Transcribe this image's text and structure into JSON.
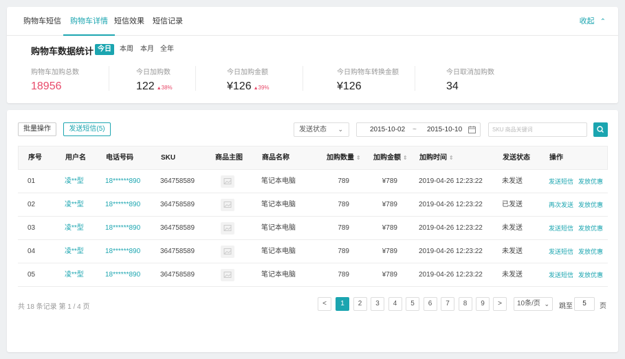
{
  "tabs": [
    "购物车短信",
    "购物车详情",
    "短信效果",
    "短信记录"
  ],
  "active_tab": 1,
  "collapse_label": "收起",
  "stats": {
    "title": "购物车数据统计",
    "periods": [
      "今日",
      "本周",
      "本月",
      "全年"
    ],
    "items": [
      {
        "label": "购物车加购总数",
        "value": "18956",
        "delta": ""
      },
      {
        "label": "今日加购数",
        "value": "122",
        "delta": "38%"
      },
      {
        "label": "今日加购金额",
        "value": "¥126",
        "delta": "39%"
      },
      {
        "label": "今日购物车转换金额",
        "value": "¥126",
        "delta": ""
      },
      {
        "label": "今日取消加购数",
        "value": "34",
        "delta": ""
      }
    ]
  },
  "toolbar": {
    "batch_label": "批量操作",
    "send_sms_label": "发送短信(5)",
    "status_select": "发送状态",
    "date_from": "2015-10-02",
    "date_sep": "~",
    "date_to": "2015-10-10",
    "search_placeholder": "SKU  商品关键词"
  },
  "table": {
    "headers": [
      "序号",
      "用户名",
      "电话号码",
      "SKU",
      "商品主图",
      "商品名称",
      "加购数量",
      "加购金额",
      "加购时间",
      "发送状态",
      "操作"
    ],
    "rows": [
      {
        "no": "01",
        "user": "凌**型",
        "phone": "18******890",
        "sku": "364758589",
        "name": "笔记本电脑",
        "qty": "789",
        "amount": "¥789",
        "time": "2019-04-26 12:23:22",
        "status": "未发送",
        "action1": "发送短信",
        "action2": "发放优惠"
      },
      {
        "no": "02",
        "user": "凌**型",
        "phone": "18******890",
        "sku": "364758589",
        "name": "笔记本电脑",
        "qty": "789",
        "amount": "¥789",
        "time": "2019-04-26 12:23:22",
        "status": "已发送",
        "action1": "再次发送",
        "action2": "发放优惠"
      },
      {
        "no": "03",
        "user": "凌**型",
        "phone": "18******890",
        "sku": "364758589",
        "name": "笔记本电脑",
        "qty": "789",
        "amount": "¥789",
        "time": "2019-04-26 12:23:22",
        "status": "未发送",
        "action1": "发送短信",
        "action2": "发放优惠"
      },
      {
        "no": "04",
        "user": "凌**型",
        "phone": "18******890",
        "sku": "364758589",
        "name": "笔记本电脑",
        "qty": "789",
        "amount": "¥789",
        "time": "2019-04-26 12:23:22",
        "status": "未发送",
        "action1": "发送短信",
        "action2": "发放优惠"
      },
      {
        "no": "05",
        "user": "凌**型",
        "phone": "18******890",
        "sku": "364758589",
        "name": "笔记本电脑",
        "qty": "789",
        "amount": "¥789",
        "time": "2019-04-26 12:23:22",
        "status": "未发送",
        "action1": "发送短信",
        "action2": "发放优惠"
      }
    ]
  },
  "pagination": {
    "summary": "共 18 条记录 第 1 / 4 页",
    "prev": "<",
    "pages": [
      "1",
      "2",
      "3",
      "4",
      "5",
      "6",
      "7",
      "8",
      "9"
    ],
    "next": ">",
    "current": "1",
    "page_size": "10条/页",
    "goto_label": "跳至",
    "goto_value": "5",
    "page_suffix": "页"
  },
  "colors": {
    "accent": "#1ba5b0",
    "highlight_red": "#e84a6a"
  }
}
